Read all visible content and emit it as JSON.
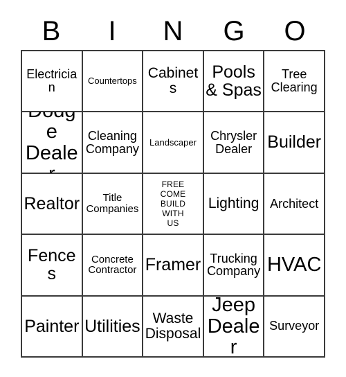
{
  "header": {
    "letters": [
      "B",
      "I",
      "N",
      "G",
      "O"
    ]
  },
  "grid": {
    "columns": 5,
    "rows": 5,
    "cells": [
      {
        "text": "Electrician",
        "size": "sz-m",
        "free": false
      },
      {
        "text": "Countertops",
        "size": "sz-xs",
        "free": false
      },
      {
        "text": "Cabinets",
        "size": "sz-l",
        "free": false
      },
      {
        "text": "Pools\n& Spas",
        "size": "sz-xl",
        "free": false
      },
      {
        "text": "Tree\nClearing",
        "size": "sz-m",
        "free": false
      },
      {
        "text": "Dodge\nDealer",
        "size": "sz-xxl",
        "free": false
      },
      {
        "text": "Cleaning\nCompany",
        "size": "sz-m",
        "free": false
      },
      {
        "text": "Landscaper",
        "size": "sz-xs",
        "free": false
      },
      {
        "text": "Chrysler\nDealer",
        "size": "sz-m",
        "free": false
      },
      {
        "text": "Builder",
        "size": "sz-xl",
        "free": false
      },
      {
        "text": "Realtor",
        "size": "sz-xl",
        "free": false
      },
      {
        "text": "Title\nCompanies",
        "size": "sz-s",
        "free": false
      },
      {
        "text": "FREE\nCOME\nBUILD\nWITH\nUS",
        "size": "sz-free",
        "free": true
      },
      {
        "text": "Lighting",
        "size": "sz-l",
        "free": false
      },
      {
        "text": "Architect",
        "size": "sz-m",
        "free": false
      },
      {
        "text": "Fences",
        "size": "sz-xl",
        "free": false
      },
      {
        "text": "Concrete\nContractor",
        "size": "sz-s",
        "free": false
      },
      {
        "text": "Framer",
        "size": "sz-xl",
        "free": false
      },
      {
        "text": "Trucking\nCompany",
        "size": "sz-m",
        "free": false
      },
      {
        "text": "HVAC",
        "size": "sz-xxl",
        "free": false
      },
      {
        "text": "Painter",
        "size": "sz-xl",
        "free": false
      },
      {
        "text": "Utilities",
        "size": "sz-xl",
        "free": false
      },
      {
        "text": "Waste\nDisposal",
        "size": "sz-l",
        "free": false
      },
      {
        "text": "Jeep\nDealer",
        "size": "sz-xxl",
        "free": false
      },
      {
        "text": "Surveyor",
        "size": "sz-m",
        "free": false
      }
    ]
  },
  "colors": {
    "background": "#ffffff",
    "text": "#000000",
    "border": "#3b3b3b"
  }
}
